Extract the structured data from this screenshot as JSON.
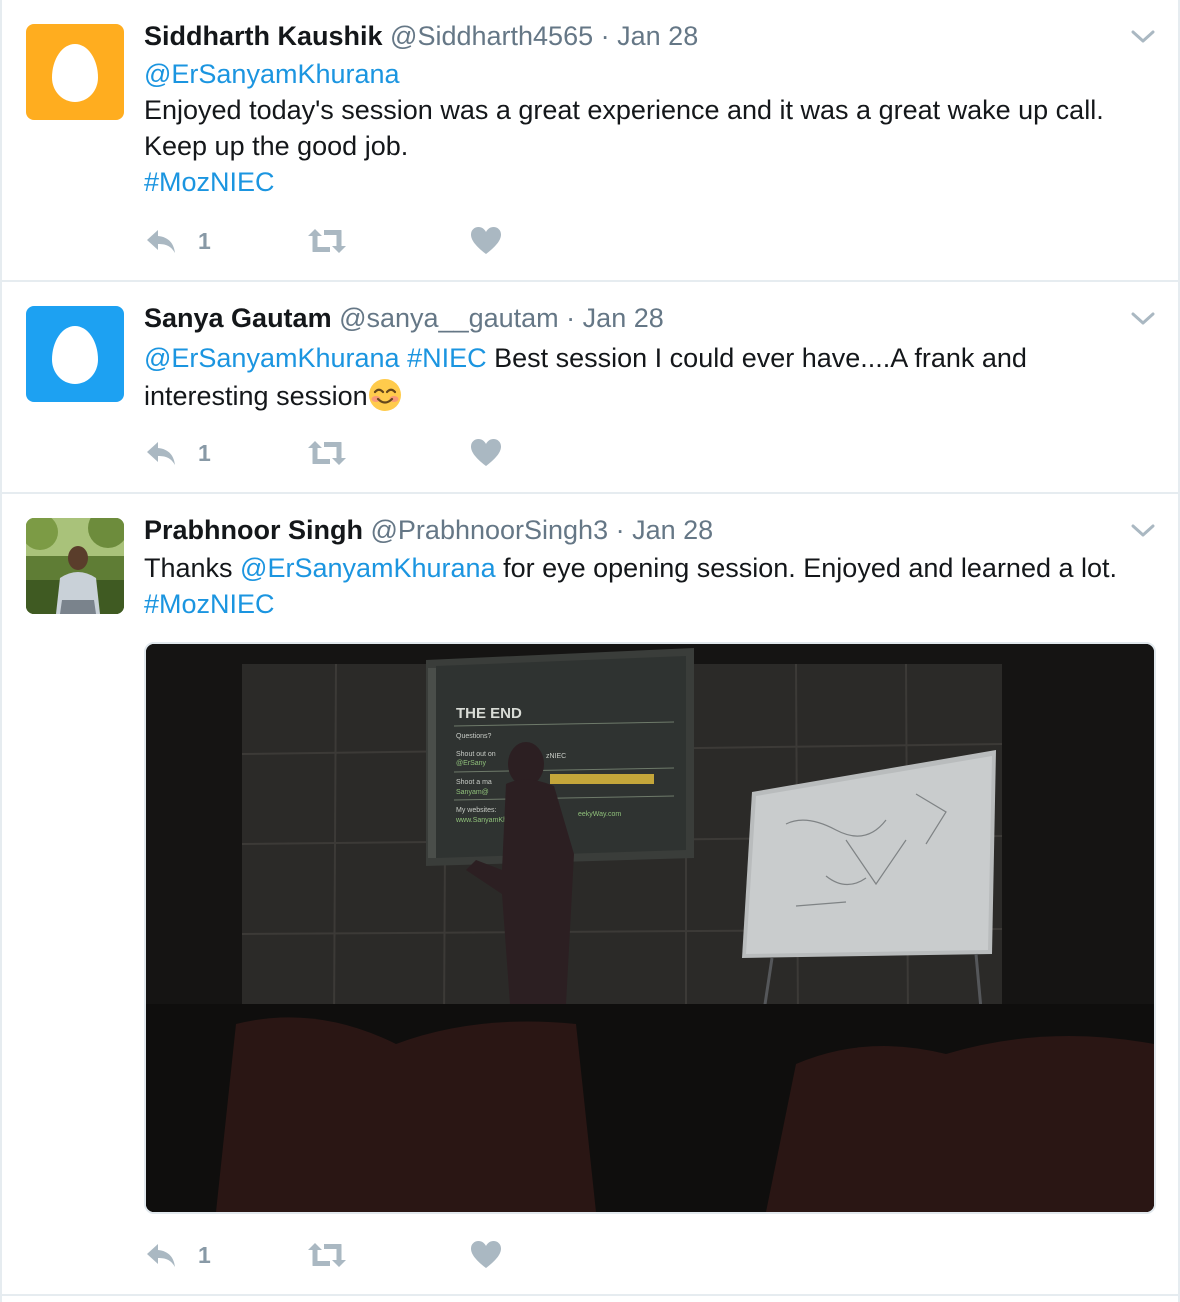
{
  "tweets": [
    {
      "display_name": "Siddharth Kaushik",
      "handle": "@Siddharth4565",
      "separator": "·",
      "date": "Jan 28",
      "avatar_color": "#ffad1f",
      "lines": [
        [
          {
            "text": "@ErSanyamKhurana",
            "link": true
          }
        ],
        [
          {
            "text": "Enjoyed today's session was a great experience and it was a great wake up call.",
            "link": false
          }
        ],
        [
          {
            "text": "Keep up the good job.",
            "link": false
          }
        ],
        [
          {
            "text": "#MozNIEC",
            "link": true
          }
        ]
      ],
      "reply_count": "1"
    },
    {
      "display_name": "Sanya Gautam",
      "handle": "@sanya__gautam",
      "separator": "·",
      "date": "Jan 28",
      "avatar_color": "#1da1f2",
      "lines": [
        [
          {
            "text": "@ErSanyamKhurana",
            "link": true
          },
          {
            "text": " ",
            "link": false
          },
          {
            "text": "#NIEC",
            "link": true
          },
          {
            "text": " Best session I could ever have....A frank and",
            "link": false
          }
        ],
        [
          {
            "text": "interesting session",
            "link": false
          }
        ]
      ],
      "emoji": "smiling-face-with-smiling-eyes",
      "reply_count": "1"
    },
    {
      "display_name": "Prabhnoor Singh",
      "handle": "@PrabhnoorSingh3",
      "separator": "·",
      "date": "Jan 28",
      "lines": [
        [
          {
            "text": "Thanks ",
            "link": false
          },
          {
            "text": "@ErSanyamKhurana",
            "link": true
          },
          {
            "text": " for eye opening session. Enjoyed and learned a lot.",
            "link": false
          }
        ],
        [
          {
            "text": "#MozNIEC",
            "link": true
          }
        ]
      ],
      "media": {
        "slide_title": "THE END",
        "slide_lines": [
          "Questions?",
          "Shout out on",
          "@ErSany",
          "Shoot a ma",
          "Sanyam@",
          "My websites:",
          "www.SanyamKhur"
        ],
        "slide_fragments": [
          "zNIEC",
          "eekyWay.com"
        ]
      },
      "reply_count": "1"
    }
  ],
  "icons": {
    "reply": "reply-icon",
    "retweet": "retweet-icon",
    "like": "heart-icon",
    "caret": "chevron-down-icon"
  },
  "colors": {
    "link": "#1b95e0",
    "muted": "#657786",
    "action_icon": "#aab8c2",
    "divider": "#e6ecf0"
  }
}
